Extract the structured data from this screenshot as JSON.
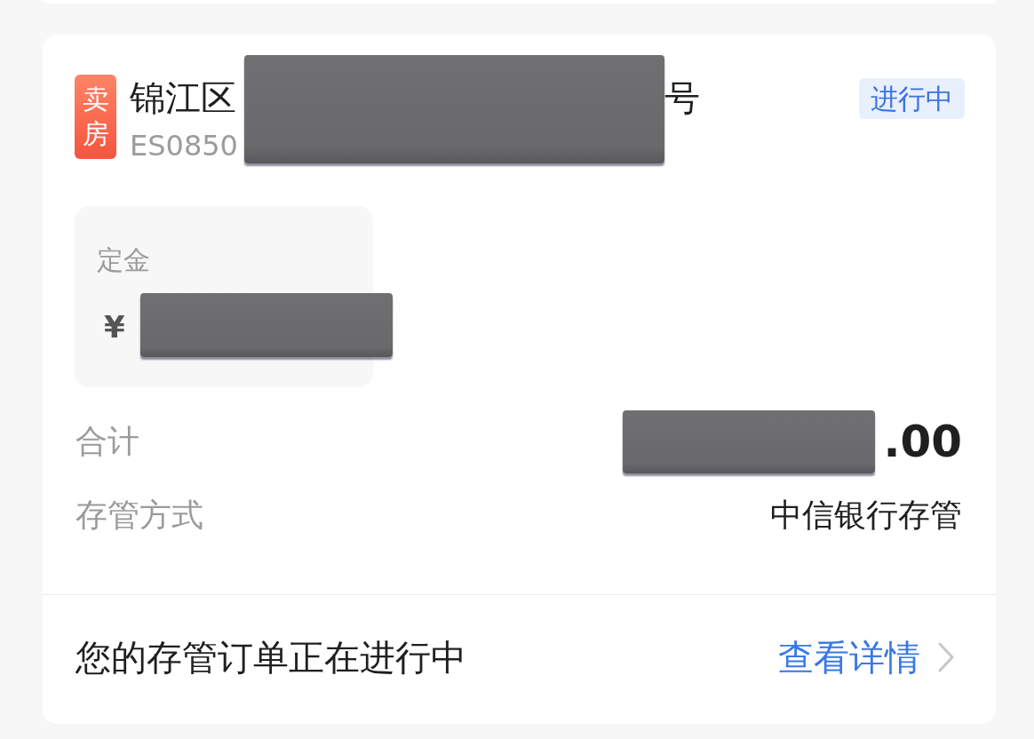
{
  "order": {
    "badge": "卖房",
    "title_start": "锦江区",
    "title_end": "号",
    "code": "ES0850",
    "header_redacted": true,
    "status": "进行中"
  },
  "deposit": {
    "label": "定金",
    "amount": "¥",
    "redacted": true
  },
  "summary": [
    {
      "kind": "amount",
      "label": "合计",
      "value": ".00",
      "redacted": true
    },
    {
      "kind": "text",
      "label": "存管方式",
      "value": "中信银行存管"
    }
  ],
  "footer": {
    "message": "您的存管订单正在进行中",
    "link": "查看详情"
  }
}
